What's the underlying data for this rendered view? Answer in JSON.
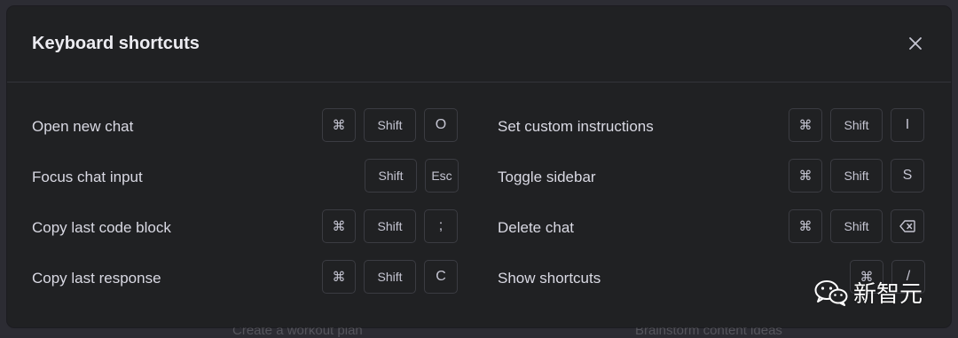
{
  "background": {
    "hint_left": "Create a workout plan",
    "hint_right": "Brainstorm content ideas"
  },
  "modal": {
    "title": "Keyboard shortcuts",
    "close_icon": "close-icon"
  },
  "shortcuts_left": [
    {
      "label": "Open new chat",
      "keys": [
        "⌘",
        "Shift",
        "O"
      ]
    },
    {
      "label": "Focus chat input",
      "keys": [
        "Shift",
        "Esc"
      ]
    },
    {
      "label": "Copy last code block",
      "keys": [
        "⌘",
        "Shift",
        ";"
      ]
    },
    {
      "label": "Copy last response",
      "keys": [
        "⌘",
        "Shift",
        "C"
      ]
    }
  ],
  "shortcuts_right": [
    {
      "label": "Set custom instructions",
      "keys": [
        "⌘",
        "Shift",
        "I"
      ]
    },
    {
      "label": "Toggle sidebar",
      "keys": [
        "⌘",
        "Shift",
        "S"
      ]
    },
    {
      "label": "Delete chat",
      "keys": [
        "⌘",
        "Shift",
        "backspace-icon"
      ]
    },
    {
      "label": "Show shortcuts",
      "keys": [
        "⌘",
        "/"
      ]
    }
  ],
  "watermark": {
    "text": "新智元",
    "icon": "wechat-icon"
  },
  "colors": {
    "modal_bg": "#202123",
    "title_text": "#ececf1",
    "label_text": "#d9d9e3",
    "key_border": "#3b3c42"
  }
}
